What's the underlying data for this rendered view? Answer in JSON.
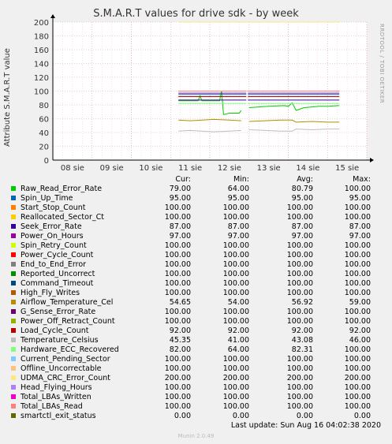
{
  "title": "S.M.A.R.T values for drive sdk - by week",
  "side_label": "RRDTOOL / TOBI OETIKER",
  "chart_data": {
    "type": "line",
    "title": "S.M.A.R.T values for drive sdk - by week",
    "ylabel": "Attribute S.M.A.R.T value",
    "xlabel": "",
    "ylim": [
      0,
      200
    ],
    "yticks": [
      0,
      20,
      40,
      60,
      80,
      100,
      120,
      140,
      160,
      180,
      200
    ],
    "xticks": [
      "08 sie",
      "09 sie",
      "10 sie",
      "11 sie",
      "12 sie",
      "13 sie",
      "14 sie",
      "15 sie"
    ],
    "grid": true,
    "series": [
      {
        "name": "Raw_Read_Error_Rate",
        "points": [
          [
            3.2,
            86
          ],
          [
            3.7,
            86
          ],
          [
            3.75,
            93
          ],
          [
            3.8,
            86
          ],
          [
            4.25,
            86
          ],
          [
            4.3,
            100
          ],
          [
            4.35,
            66
          ],
          [
            4.5,
            68
          ],
          [
            4.75,
            68
          ],
          [
            4.8,
            72
          ],
          [
            5.0,
            76
          ],
          [
            5.5,
            78
          ],
          [
            5.9,
            79
          ],
          [
            6.0,
            78
          ],
          [
            6.1,
            83
          ],
          [
            6.2,
            72
          ],
          [
            6.4,
            76
          ],
          [
            6.8,
            78
          ],
          [
            7.0,
            78
          ],
          [
            7.3,
            79
          ]
        ]
      },
      {
        "name": "Spin_Up_Time",
        "points": [
          [
            3.2,
            95
          ],
          [
            7.3,
            95
          ]
        ]
      },
      {
        "name": "Start_Stop_Count",
        "points": [
          [
            3.2,
            100
          ],
          [
            7.3,
            100
          ]
        ]
      },
      {
        "name": "Reallocated_Sector_Ct",
        "points": [
          [
            3.2,
            100
          ],
          [
            7.3,
            100
          ]
        ]
      },
      {
        "name": "Seek_Error_Rate",
        "points": [
          [
            3.2,
            87
          ],
          [
            7.3,
            87
          ]
        ]
      },
      {
        "name": "Power_On_Hours",
        "points": [
          [
            3.2,
            97
          ],
          [
            7.3,
            97
          ]
        ]
      },
      {
        "name": "Spin_Retry_Count",
        "points": [
          [
            3.2,
            100
          ],
          [
            7.3,
            100
          ]
        ]
      },
      {
        "name": "Power_Cycle_Count",
        "points": [
          [
            3.2,
            100
          ],
          [
            7.3,
            100
          ]
        ]
      },
      {
        "name": "End_to_End_Error",
        "points": [
          [
            3.2,
            100
          ],
          [
            7.3,
            100
          ]
        ]
      },
      {
        "name": "Reported_Uncorrect",
        "points": [
          [
            3.2,
            100
          ],
          [
            7.3,
            100
          ]
        ]
      },
      {
        "name": "Command_Timeout",
        "points": [
          [
            3.2,
            100
          ],
          [
            7.3,
            100
          ]
        ]
      },
      {
        "name": "High_Fly_Writes",
        "points": [
          [
            3.2,
            100
          ],
          [
            7.3,
            100
          ]
        ]
      },
      {
        "name": "Airflow_Temperature_Cel",
        "points": [
          [
            3.2,
            58
          ],
          [
            3.5,
            57
          ],
          [
            3.8,
            58
          ],
          [
            4.1,
            59
          ],
          [
            4.5,
            58
          ],
          [
            4.8,
            57
          ],
          [
            5.0,
            56
          ],
          [
            5.4,
            57
          ],
          [
            5.8,
            58
          ],
          [
            6.1,
            58
          ],
          [
            6.2,
            55
          ],
          [
            6.6,
            56
          ],
          [
            7.0,
            55
          ],
          [
            7.3,
            55
          ]
        ]
      },
      {
        "name": "G_Sense_Error_Rate",
        "points": [
          [
            3.2,
            100
          ],
          [
            7.3,
            100
          ]
        ]
      },
      {
        "name": "Power_Off_Retract_Count",
        "points": [
          [
            3.2,
            100
          ],
          [
            7.3,
            100
          ]
        ]
      },
      {
        "name": "Load_Cycle_Count",
        "points": [
          [
            3.2,
            92
          ],
          [
            7.3,
            92
          ]
        ]
      },
      {
        "name": "Temperature_Celsius",
        "points": [
          [
            3.2,
            42
          ],
          [
            3.5,
            43
          ],
          [
            3.8,
            42
          ],
          [
            4.1,
            41
          ],
          [
            4.5,
            42
          ],
          [
            4.8,
            43
          ],
          [
            5.0,
            44
          ],
          [
            5.4,
            43
          ],
          [
            5.8,
            42
          ],
          [
            6.1,
            42
          ],
          [
            6.2,
            45
          ],
          [
            6.6,
            44
          ],
          [
            7.0,
            45
          ],
          [
            7.3,
            45
          ]
        ]
      },
      {
        "name": "Hardware_ECC_Recovered",
        "points": [
          [
            3.2,
            82
          ],
          [
            7.3,
            82
          ]
        ]
      },
      {
        "name": "Current_Pending_Sector",
        "points": [
          [
            3.2,
            100
          ],
          [
            7.3,
            100
          ]
        ]
      },
      {
        "name": "Offline_Uncorrectable",
        "points": [
          [
            3.2,
            100
          ],
          [
            7.3,
            100
          ]
        ]
      },
      {
        "name": "UDMA_CRC_Error_Count",
        "points": [
          [
            3.2,
            200
          ],
          [
            7.3,
            200
          ]
        ]
      },
      {
        "name": "Head_Flying_Hours",
        "points": [
          [
            3.2,
            100
          ],
          [
            7.3,
            100
          ]
        ]
      },
      {
        "name": "Total_LBAs_Written",
        "points": [
          [
            3.2,
            100
          ],
          [
            7.3,
            100
          ]
        ]
      },
      {
        "name": "Total_LBAs_Read",
        "points": [
          [
            3.2,
            100
          ],
          [
            7.3,
            100
          ]
        ]
      },
      {
        "name": "smartctl_exit_status",
        "points": [
          [
            3.2,
            0
          ],
          [
            7.3,
            0
          ]
        ]
      }
    ],
    "gap": [
      4.93,
      4.97
    ]
  },
  "legend": {
    "headers": {
      "cur": "Cur:",
      "min": "Min:",
      "avg": "Avg:",
      "max": "Max:"
    },
    "rows": [
      {
        "name": "Raw_Read_Error_Rate",
        "color": "#00cc00",
        "cur": "79.00",
        "min": "64.00",
        "avg": "80.79",
        "max": "100.00"
      },
      {
        "name": "Spin_Up_Time",
        "color": "#0066b3",
        "cur": "95.00",
        "min": "95.00",
        "avg": "95.00",
        "max": "95.00"
      },
      {
        "name": "Start_Stop_Count",
        "color": "#ff8000",
        "cur": "100.00",
        "min": "100.00",
        "avg": "100.00",
        "max": "100.00"
      },
      {
        "name": "Reallocated_Sector_Ct",
        "color": "#ffcc00",
        "cur": "100.00",
        "min": "100.00",
        "avg": "100.00",
        "max": "100.00"
      },
      {
        "name": "Seek_Error_Rate",
        "color": "#330099",
        "cur": "87.00",
        "min": "87.00",
        "avg": "87.00",
        "max": "87.00"
      },
      {
        "name": "Power_On_Hours",
        "color": "#990099",
        "cur": "97.00",
        "min": "97.00",
        "avg": "97.00",
        "max": "97.00"
      },
      {
        "name": "Spin_Retry_Count",
        "color": "#ccff00",
        "cur": "100.00",
        "min": "100.00",
        "avg": "100.00",
        "max": "100.00"
      },
      {
        "name": "Power_Cycle_Count",
        "color": "#ff0000",
        "cur": "100.00",
        "min": "100.00",
        "avg": "100.00",
        "max": "100.00"
      },
      {
        "name": "End_to_End_Error",
        "color": "#808080",
        "cur": "100.00",
        "min": "100.00",
        "avg": "100.00",
        "max": "100.00"
      },
      {
        "name": "Reported_Uncorrect",
        "color": "#008f00",
        "cur": "100.00",
        "min": "100.00",
        "avg": "100.00",
        "max": "100.00"
      },
      {
        "name": "Command_Timeout",
        "color": "#00487d",
        "cur": "100.00",
        "min": "100.00",
        "avg": "100.00",
        "max": "100.00"
      },
      {
        "name": "High_Fly_Writes",
        "color": "#b35a00",
        "cur": "100.00",
        "min": "100.00",
        "avg": "100.00",
        "max": "100.00"
      },
      {
        "name": "Airflow_Temperature_Cel",
        "color": "#b38f00",
        "cur": "54.65",
        "min": "54.00",
        "avg": "56.92",
        "max": "59.00"
      },
      {
        "name": "G_Sense_Error_Rate",
        "color": "#6b006b",
        "cur": "100.00",
        "min": "100.00",
        "avg": "100.00",
        "max": "100.00"
      },
      {
        "name": "Power_Off_Retract_Count",
        "color": "#8fb300",
        "cur": "100.00",
        "min": "100.00",
        "avg": "100.00",
        "max": "100.00"
      },
      {
        "name": "Load_Cycle_Count",
        "color": "#b30000",
        "cur": "92.00",
        "min": "92.00",
        "avg": "92.00",
        "max": "92.00"
      },
      {
        "name": "Temperature_Celsius",
        "color": "#bebebe",
        "cur": "45.35",
        "min": "41.00",
        "avg": "43.08",
        "max": "46.00"
      },
      {
        "name": "Hardware_ECC_Recovered",
        "color": "#80ff80",
        "cur": "82.00",
        "min": "64.00",
        "avg": "82.31",
        "max": "100.00"
      },
      {
        "name": "Current_Pending_Sector",
        "color": "#80c9ff",
        "cur": "100.00",
        "min": "100.00",
        "avg": "100.00",
        "max": "100.00"
      },
      {
        "name": "Offline_Uncorrectable",
        "color": "#ffc080",
        "cur": "100.00",
        "min": "100.00",
        "avg": "100.00",
        "max": "100.00"
      },
      {
        "name": "UDMA_CRC_Error_Count",
        "color": "#ffe680",
        "cur": "200.00",
        "min": "200.00",
        "avg": "200.00",
        "max": "200.00"
      },
      {
        "name": "Head_Flying_Hours",
        "color": "#aa80ff",
        "cur": "100.00",
        "min": "100.00",
        "avg": "100.00",
        "max": "100.00"
      },
      {
        "name": "Total_LBAs_Written",
        "color": "#ee00cc",
        "cur": "100.00",
        "min": "100.00",
        "avg": "100.00",
        "max": "100.00"
      },
      {
        "name": "Total_LBAs_Read",
        "color": "#ff8080",
        "cur": "100.00",
        "min": "100.00",
        "avg": "100.00",
        "max": "100.00"
      },
      {
        "name": "smartctl_exit_status",
        "color": "#666600",
        "cur": "0.00",
        "min": "0.00",
        "avg": "0.00",
        "max": "0.00"
      }
    ]
  },
  "last_update": "Last update: Sun Aug 16 04:02:38 2020",
  "footer": "Munin 2.0.49"
}
